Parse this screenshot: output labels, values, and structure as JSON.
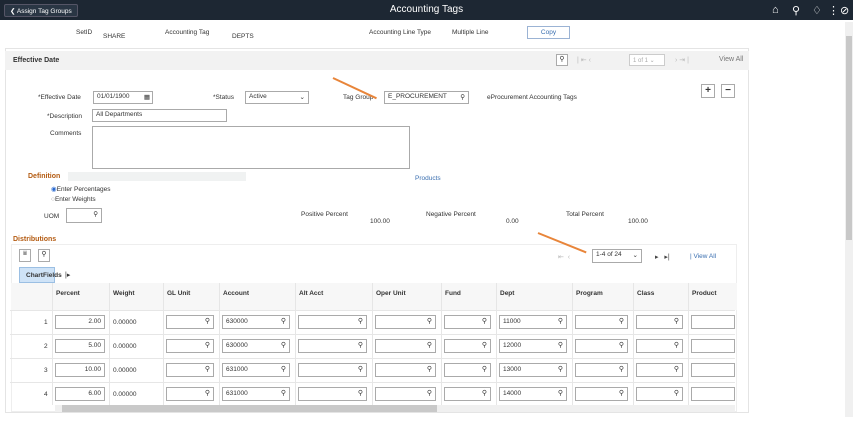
{
  "header": {
    "back_label": "Assign Tag Groups",
    "title": "Accounting Tags",
    "icons": [
      "home-icon",
      "search-icon",
      "bell-icon",
      "more-icon",
      "nav-compass-icon"
    ]
  },
  "top": {
    "setid_label": "SetID",
    "setid": "SHARE",
    "tag_label": "Accounting Tag",
    "tag": "DEPTS",
    "line_type_label": "Accounting Line Type",
    "line_type": "Multiple Line",
    "copy_label": "Copy"
  },
  "effdate_bar": {
    "title": "Effective Date",
    "pager": "1 of 1",
    "view_all": "View All"
  },
  "form": {
    "eff_date_label": "*Effective Date",
    "eff_date": "01/01/1900",
    "status_label": "*Status",
    "status": "Active",
    "tag_group_label": "Tag Group",
    "tag_group": "E_PROCUREMENT",
    "tag_group_desc": "eProcurement Accounting Tags",
    "description_label": "*Description",
    "description": "All Departments",
    "comments_label": "Comments",
    "comments": ""
  },
  "definition": {
    "title": "Definition",
    "products_link": "Products",
    "opt1": "Enter Percentages",
    "opt2": "Enter Weights",
    "selected": "Enter Percentages",
    "uom_label": "UOM",
    "pos_label": "Positive Percent",
    "pos": "100.00",
    "neg_label": "Negative Percent",
    "neg": "0.00",
    "tot_label": "Total Percent",
    "tot": "100.00"
  },
  "distributions": {
    "title": "Distributions",
    "pager": "1-4 of 24",
    "view_all": "View All",
    "tab": "ChartFields",
    "columns": [
      "Percent",
      "Weight",
      "GL Unit",
      "Account",
      "Alt Acct",
      "Oper Unit",
      "Fund",
      "Dept",
      "Program",
      "Class",
      "Product"
    ],
    "rows": [
      {
        "n": "1",
        "percent": "2.00",
        "weight": "0.00000",
        "account": "630000",
        "dept": "11000"
      },
      {
        "n": "2",
        "percent": "5.00",
        "weight": "0.00000",
        "account": "630000",
        "dept": "12000"
      },
      {
        "n": "3",
        "percent": "10.00",
        "weight": "0.00000",
        "account": "631000",
        "dept": "13000"
      },
      {
        "n": "4",
        "percent": "6.00",
        "weight": "0.00000",
        "account": "631000",
        "dept": "14000"
      }
    ]
  },
  "colors": {
    "header_bg": "#1d2733",
    "accent_orange": "#b35a10",
    "link": "#3a6fb0",
    "annotation_arrow": "#e8853a"
  }
}
